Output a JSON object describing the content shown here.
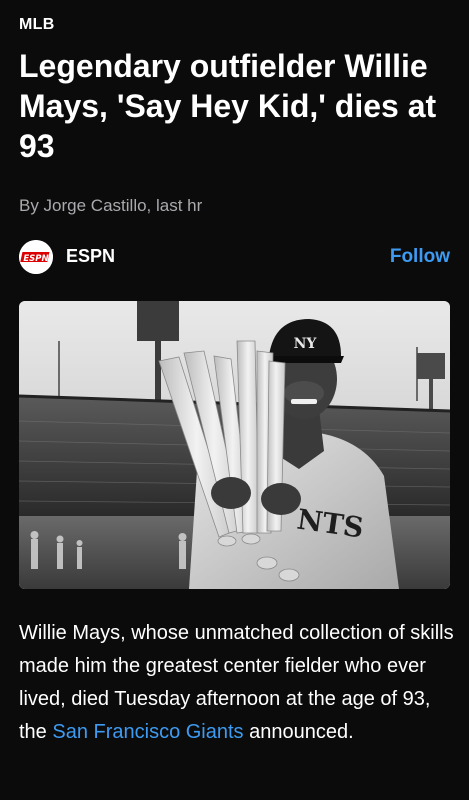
{
  "article": {
    "category": "MLB",
    "headline": "Legendary outfielder Willie Mays, 'Say Hey Kid,' dies at 93",
    "byline": "By Jorge Castillo, last hr"
  },
  "source": {
    "name": "ESPN",
    "logo_text": "ESPN",
    "logo_icon": "espn-logo-icon",
    "follow_label": "Follow"
  },
  "image": {
    "alt": "Willie Mays holding baseball bats in a Giants uniform",
    "jersey_text": "NTS"
  },
  "body": {
    "text_before_link": "Willie Mays, whose unmatched collection of skills made him the greatest center fielder who ever lived, died Tuesday afternoon at the age of 93, the ",
    "link_text": "San Francisco Giants",
    "text_after_link": " announced."
  },
  "colors": {
    "background": "#0b0b0b",
    "accent_link": "#3d9bf2",
    "byline": "#a9a9ae",
    "espn_red": "#d00"
  }
}
